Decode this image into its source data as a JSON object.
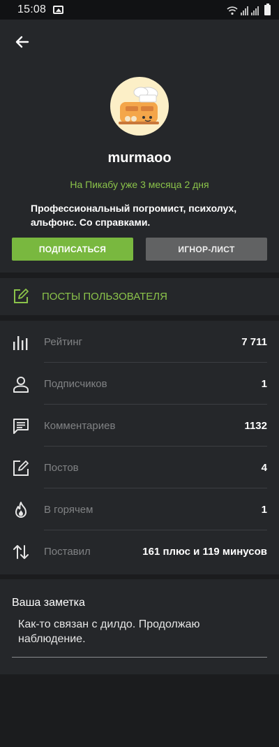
{
  "status_bar": {
    "time": "15:08"
  },
  "profile": {
    "username": "murmaoo",
    "member_since": "На Пикабу уже 3 месяца 2 дня",
    "bio": "Профессиональный погромист, психолух, альфонс. Со справками.",
    "subscribe_label": "ПОДПИСАТЬСЯ",
    "ignore_label": "ИГНОР-ЛИСТ"
  },
  "posts_link": {
    "label": "ПОСТЫ ПОЛЬЗОВАТЕЛЯ"
  },
  "stats": [
    {
      "icon": "bar-chart-icon",
      "label": "Рейтинг",
      "value": "7 711"
    },
    {
      "icon": "person-icon",
      "label": "Подписчиков",
      "value": "1"
    },
    {
      "icon": "comment-icon",
      "label": "Комментариев",
      "value": "1132"
    },
    {
      "icon": "edit-icon",
      "label": "Постов",
      "value": "4"
    },
    {
      "icon": "flame-icon",
      "label": "В горячем",
      "value": "1"
    },
    {
      "icon": "swap-vertical-icon",
      "label": "Поставил",
      "value": "161 плюс и 119 минусов"
    }
  ],
  "note": {
    "title": "Ваша заметка",
    "text": "Как-то связан с дилдо. Продолжаю наблюдение."
  },
  "colors": {
    "accent": "#8bc34a",
    "button_primary": "#79b83f",
    "button_secondary": "#616263",
    "card": "#25272a",
    "background": "#1b1c1e"
  }
}
